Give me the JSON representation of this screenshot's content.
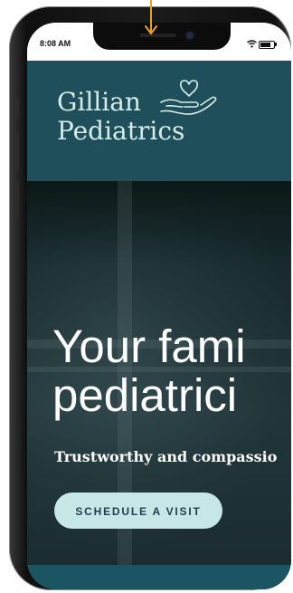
{
  "status_bar": {
    "time": "8:08 AM",
    "wifi_icon": "wifi-icon",
    "battery_level": 0.75
  },
  "header": {
    "brand_line1": "Gillian",
    "brand_line2": "Pediatrics",
    "logo_icon": "heart-hand-icon"
  },
  "hero": {
    "headline_line1": "Your fami",
    "headline_line2": "pediatrici",
    "subheadline": "Trustworthy and compassio",
    "cta_label": "SCHEDULE A VISIT"
  },
  "annotation": {
    "arrow_icon": "arrow-down-icon",
    "arrow_color": "#f0a020"
  },
  "colors": {
    "header_bg": "#1f4f5b",
    "cta_bg": "#c7e6e6",
    "brand_text": "#d5ece9"
  }
}
